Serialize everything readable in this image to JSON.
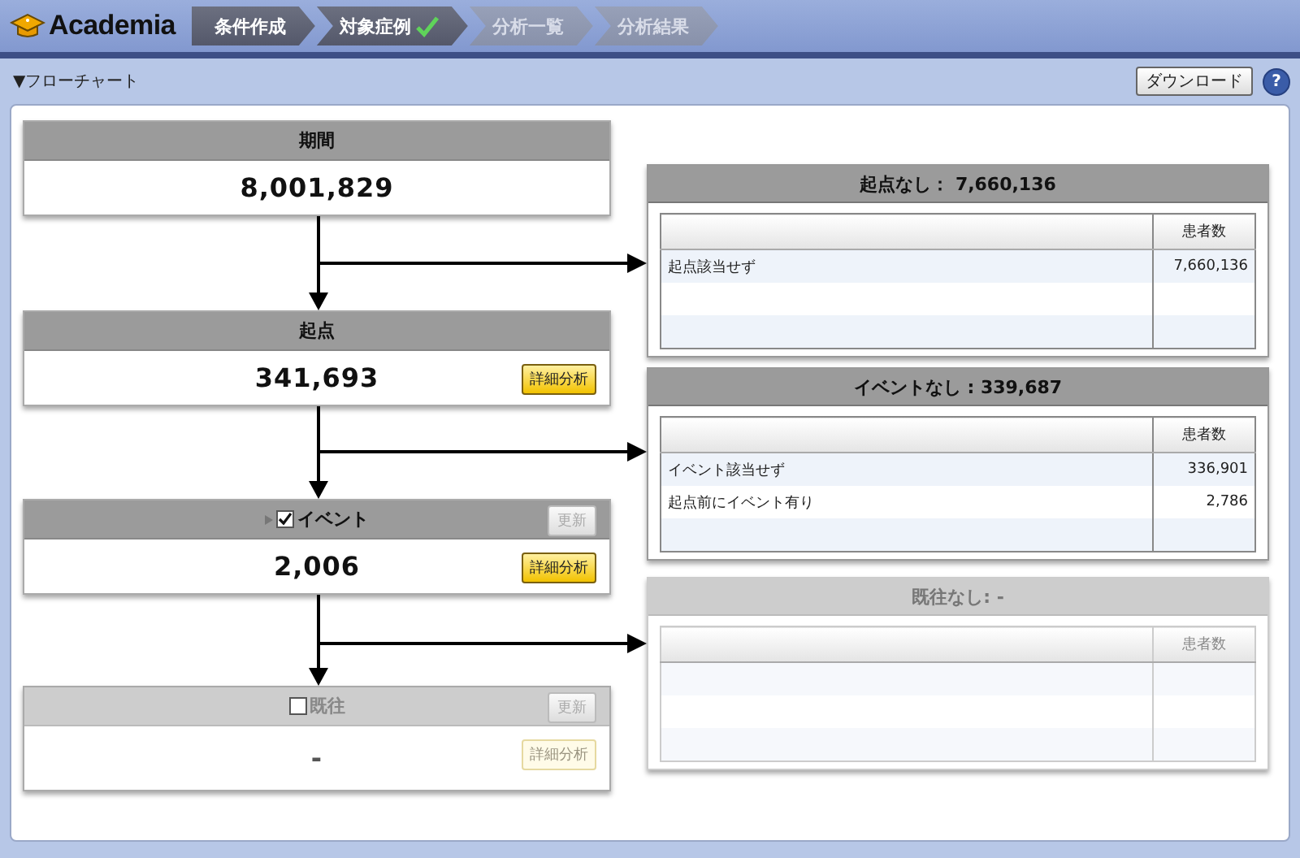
{
  "header": {
    "logo": "Academia",
    "steps": [
      {
        "label": "条件作成",
        "done": true,
        "checked": false
      },
      {
        "label": "対象症例",
        "done": true,
        "checked": true
      },
      {
        "label": "分析一覧",
        "done": false,
        "checked": false
      },
      {
        "label": "分析結果",
        "done": false,
        "checked": false
      }
    ]
  },
  "section": {
    "label": "▼フローチャート",
    "download_button": "ダウンロード",
    "help_button": "?"
  },
  "stages": [
    {
      "kind": "fixed",
      "title": "期間",
      "count": "8,001,829",
      "disabled": false
    },
    {
      "kind": "fixed",
      "title": "起点",
      "count": "341,693",
      "disabled": false,
      "detail_button": "詳細分析"
    },
    {
      "kind": "optional",
      "title": "イベント",
      "count": "2,006",
      "disabled": false,
      "checked": true,
      "expandable": true,
      "update_button": "更新",
      "detail_button": "詳細分析"
    },
    {
      "kind": "optional",
      "title": "既往",
      "count": "-",
      "disabled": true,
      "checked": false,
      "expandable": false,
      "update_button": "更新",
      "detail_button": "詳細分析"
    }
  ],
  "results": [
    {
      "title": "起点なし： 7,660,136",
      "disabled": false,
      "count_column": "患者数",
      "rows": [
        {
          "label": "起点該当せず",
          "count": "7,660,136"
        }
      ]
    },
    {
      "title": "イベントなし : 339,687",
      "disabled": false,
      "count_column": "患者数",
      "rows": [
        {
          "label": "イベント該当せず",
          "count": "336,901"
        },
        {
          "label": "起点前にイベント有り",
          "count": "2,786"
        }
      ]
    },
    {
      "title": "既往なし: -",
      "disabled": true,
      "count_column": "患者数"
    }
  ]
}
